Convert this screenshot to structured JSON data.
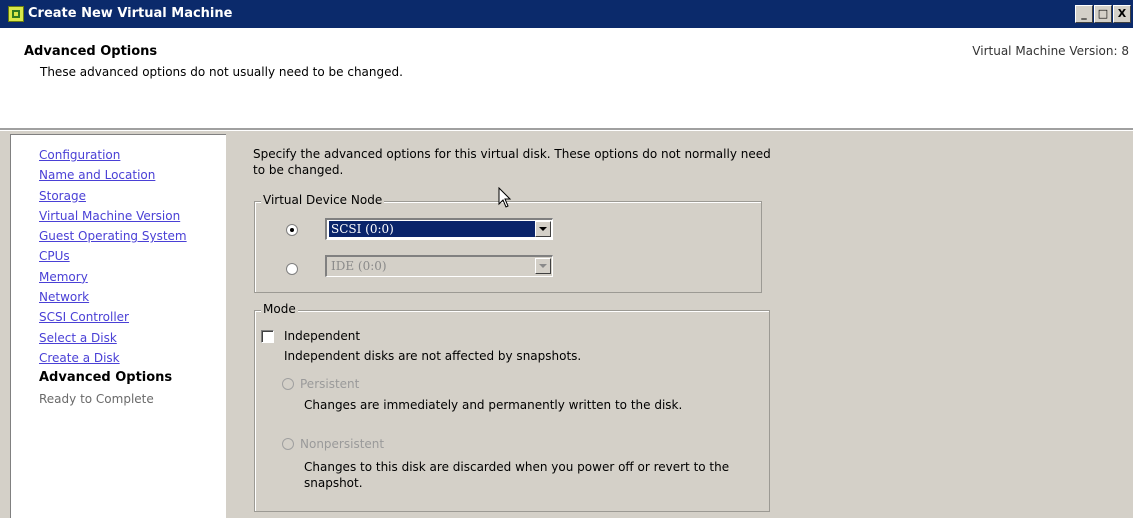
{
  "window": {
    "title": "Create New Virtual Machine",
    "minimize": "_",
    "maximize": "□",
    "close": "X"
  },
  "header": {
    "title": "Advanced Options",
    "subtitle": "These advanced options do not usually need to be changed.",
    "vm_version": "Virtual Machine Version: 8"
  },
  "nav": {
    "items": [
      {
        "label": "Configuration",
        "state": "link"
      },
      {
        "label": "Name and Location",
        "state": "link"
      },
      {
        "label": "Storage",
        "state": "link"
      },
      {
        "label": "Virtual Machine Version",
        "state": "link"
      },
      {
        "label": "Guest Operating System",
        "state": "link"
      },
      {
        "label": "CPUs",
        "state": "link"
      },
      {
        "label": "Memory",
        "state": "link"
      },
      {
        "label": "Network",
        "state": "link"
      },
      {
        "label": "SCSI Controller",
        "state": "link"
      },
      {
        "label": "Select a Disk",
        "state": "link"
      },
      {
        "label": "Create a Disk",
        "state": "link"
      },
      {
        "label": "Advanced Options",
        "state": "current"
      },
      {
        "label": "Ready to Complete",
        "state": "pending"
      }
    ]
  },
  "main": {
    "intro_line1": "Specify the advanced options for this virtual disk. These options do not normally need",
    "intro_line2": "to be changed.",
    "virtual_device_node": {
      "legend": "Virtual Device Node",
      "scsi_value": "SCSI (0:0)",
      "ide_value": "IDE (0:0)",
      "selected": "scsi"
    },
    "mode": {
      "legend": "Mode",
      "independent_label": "Independent",
      "independent_checked": false,
      "independent_desc": "Independent disks are not affected by snapshots.",
      "persistent_label": "Persistent",
      "persistent_desc": "Changes are immediately and permanently written to the disk.",
      "nonpersistent_label": "Nonpersistent",
      "nonpersistent_desc_line1": "Changes to this disk are discarded when you power off or revert to the",
      "nonpersistent_desc_line2": "snapshot."
    }
  },
  "icons": {
    "app": "vm-wizard-icon",
    "cursor": "mouse-pointer-icon",
    "dropdown": "chevron-down-icon"
  }
}
